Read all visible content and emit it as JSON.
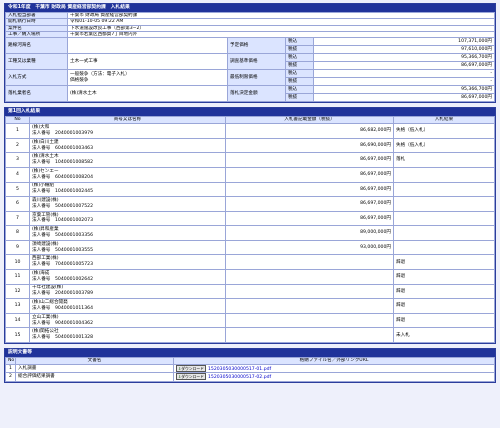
{
  "header": {
    "title": "令和1年度　千葉市 財政局 資産経営部契約課　入札結果"
  },
  "info": {
    "rows_left": [
      {
        "label": "入札担当部署",
        "value": "千葉市 財政局 資産経営部契約課"
      },
      {
        "label": "開札執行日時",
        "value": "令和01-10-05 09:22 AM"
      },
      {
        "label": "案件名",
        "value": "下水道施設改良工事（西部第3−2）"
      },
      {
        "label": "工事／納入場所",
        "value": "千葉市若葉区西都賀7丁目地内外"
      }
    ],
    "route_label": "路線河海名",
    "route_value": "",
    "type_label": "工種又は業種",
    "type_value": "土木一式工事",
    "method_label": "入札方式",
    "method_value": "一般競争（方法：電子入札）\n価格競争",
    "winner_label": "落札業者名",
    "winner_value": "(株)清水土木",
    "price_blocks": [
      {
        "label": "予定価格",
        "tax1": "税込",
        "val1": "107,371,000円",
        "tax2": "税抜",
        "val2": "97,610,000円"
      },
      {
        "label": "調査基準価格",
        "tax1": "税込",
        "val1": "95,366,700円",
        "tax2": "税抜",
        "val2": "86,697,000円"
      },
      {
        "label": "最低制限価格",
        "tax1": "税込",
        "val1": "-",
        "tax2": "税抜",
        "val2": "-"
      },
      {
        "label": "落札決定金額",
        "tax1": "税込",
        "val1": "95,366,700円",
        "tax2": "税抜",
        "val2": "86,697,000円"
      }
    ]
  },
  "bids": {
    "title": "第1回入札結果",
    "col_no": "No",
    "col_company": "商号又は名称",
    "col_amount": "入札書記載金額（税抜）",
    "col_result": "入札結果",
    "corp_label": "法人番号",
    "rows": [
      {
        "no": "1",
        "name": "(株)大和",
        "corp": "2040001003979",
        "amount": "86,682,000円",
        "result": "失格（低入札）"
      },
      {
        "no": "2",
        "name": "(株)白川土建",
        "corp": "6040001003463",
        "amount": "86,690,000円",
        "result": "失格（低入札）"
      },
      {
        "no": "3",
        "name": "(株)清水土木",
        "corp": "1040001008582",
        "amount": "86,697,000円",
        "result": "落札"
      },
      {
        "no": "4",
        "name": "(株)センエー",
        "corp": "6040001008204",
        "amount": "86,697,000円",
        "result": ""
      },
      {
        "no": "5",
        "name": "(株)小櫃組",
        "corp": "1040001002445",
        "amount": "86,697,000円",
        "result": ""
      },
      {
        "no": "6",
        "name": "森川建設(株)",
        "corp": "5040001007522",
        "amount": "86,697,000円",
        "result": ""
      },
      {
        "no": "7",
        "name": "京葉工管(株)",
        "corp": "1040001002073",
        "amount": "86,697,000円",
        "result": ""
      },
      {
        "no": "8",
        "name": "(株)昇和産業",
        "corp": "5040001003356",
        "amount": "89,000,000円",
        "result": ""
      },
      {
        "no": "9",
        "name": "須崎建設(株)",
        "corp": "5040001003555",
        "amount": "93,000,000円",
        "result": ""
      },
      {
        "no": "10",
        "name": "西部工業(株)",
        "corp": "7040001005723",
        "amount": "",
        "result": "辞退"
      },
      {
        "no": "11",
        "name": "(株)海成",
        "corp": "5040001002642",
        "amount": "",
        "result": "辞退"
      },
      {
        "no": "12",
        "name": "千年社建設(株)",
        "corp": "2040001003789",
        "amount": "",
        "result": "辞退"
      },
      {
        "no": "13",
        "name": "(株)山二総合開発",
        "corp": "9040001011364",
        "amount": "",
        "result": "辞退"
      },
      {
        "no": "14",
        "name": "立山工業(株)",
        "corp": "9040001004362",
        "amount": "",
        "result": "辞退"
      },
      {
        "no": "15",
        "name": "(株)関拓公社",
        "corp": "5040001001328",
        "amount": "",
        "result": "未入札"
      }
    ]
  },
  "docs": {
    "title": "説明文書等",
    "col_no": "No",
    "col_name": "文書名",
    "col_file": "格納ファイル名／外部リンクURL",
    "download_label": "ダウンロード",
    "rows": [
      {
        "no": "1",
        "name": "入札調書",
        "file": "1520305030000517-01.pdf"
      },
      {
        "no": "2",
        "name": "総合評価結果調書",
        "file": "1520305030000517-02.pdf"
      }
    ]
  },
  "colors": {
    "header_blue": "#20339a",
    "label_bg": "#dbe4ff",
    "border": "#9aa6d8"
  }
}
